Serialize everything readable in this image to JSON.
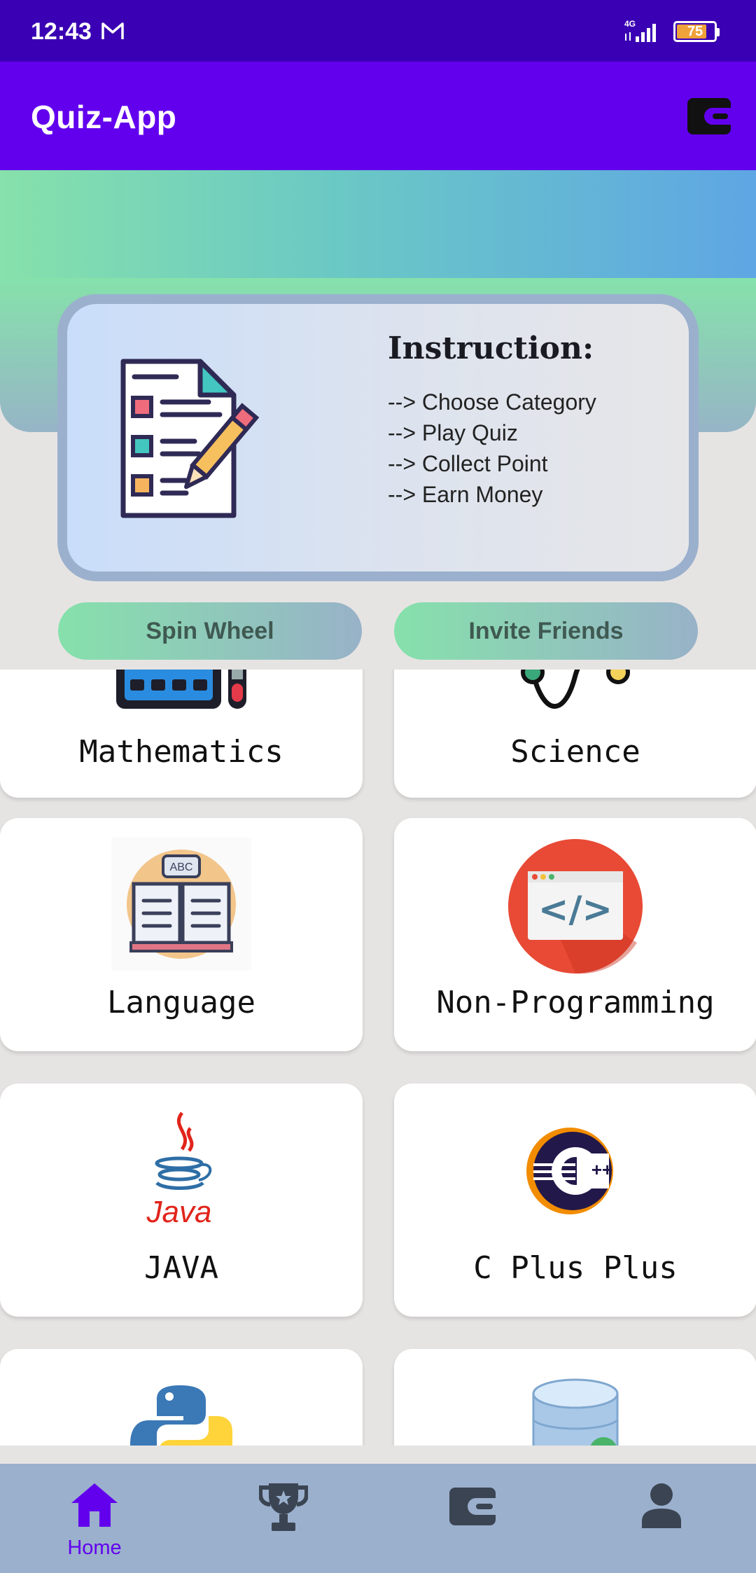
{
  "status_bar": {
    "time": "12:43",
    "network": "4G",
    "battery": "75"
  },
  "app_bar": {
    "title": "Quiz-App",
    "wallet_icon": "wallet-icon"
  },
  "instruction": {
    "heading": "Instruction:",
    "steps": [
      "--> Choose Category",
      "--> Play Quiz",
      "--> Collect Point",
      "--> Earn Money"
    ],
    "icon": "checklist-pencil-icon"
  },
  "buttons": {
    "spin": "Spin Wheel",
    "invite": "Invite Friends"
  },
  "categories": [
    {
      "label": "Mathematics",
      "icon": "calculator-icon"
    },
    {
      "label": "Science",
      "icon": "molecule-icon"
    },
    {
      "label": "Language",
      "icon": "book-abc-icon"
    },
    {
      "label": "Non-Programming",
      "icon": "code-window-icon"
    },
    {
      "label": "JAVA",
      "icon": "java-logo-icon"
    },
    {
      "label": "C Plus Plus",
      "icon": "cpp-logo-icon"
    },
    {
      "label": "",
      "icon": "python-logo-icon"
    },
    {
      "label": "",
      "icon": "database-icon"
    }
  ],
  "bottom_nav": [
    {
      "label": "Home",
      "icon": "home-icon",
      "active": true
    },
    {
      "label": "",
      "icon": "trophy-icon",
      "active": false
    },
    {
      "label": "",
      "icon": "wallet-icon",
      "active": false
    },
    {
      "label": "",
      "icon": "profile-icon",
      "active": false
    }
  ],
  "colors": {
    "status_bar": "#3a00b4",
    "app_bar": "#6200ee",
    "bottom_nav": "#9bb0cd",
    "active": "#6200ee",
    "inactive": "#3b4452"
  }
}
